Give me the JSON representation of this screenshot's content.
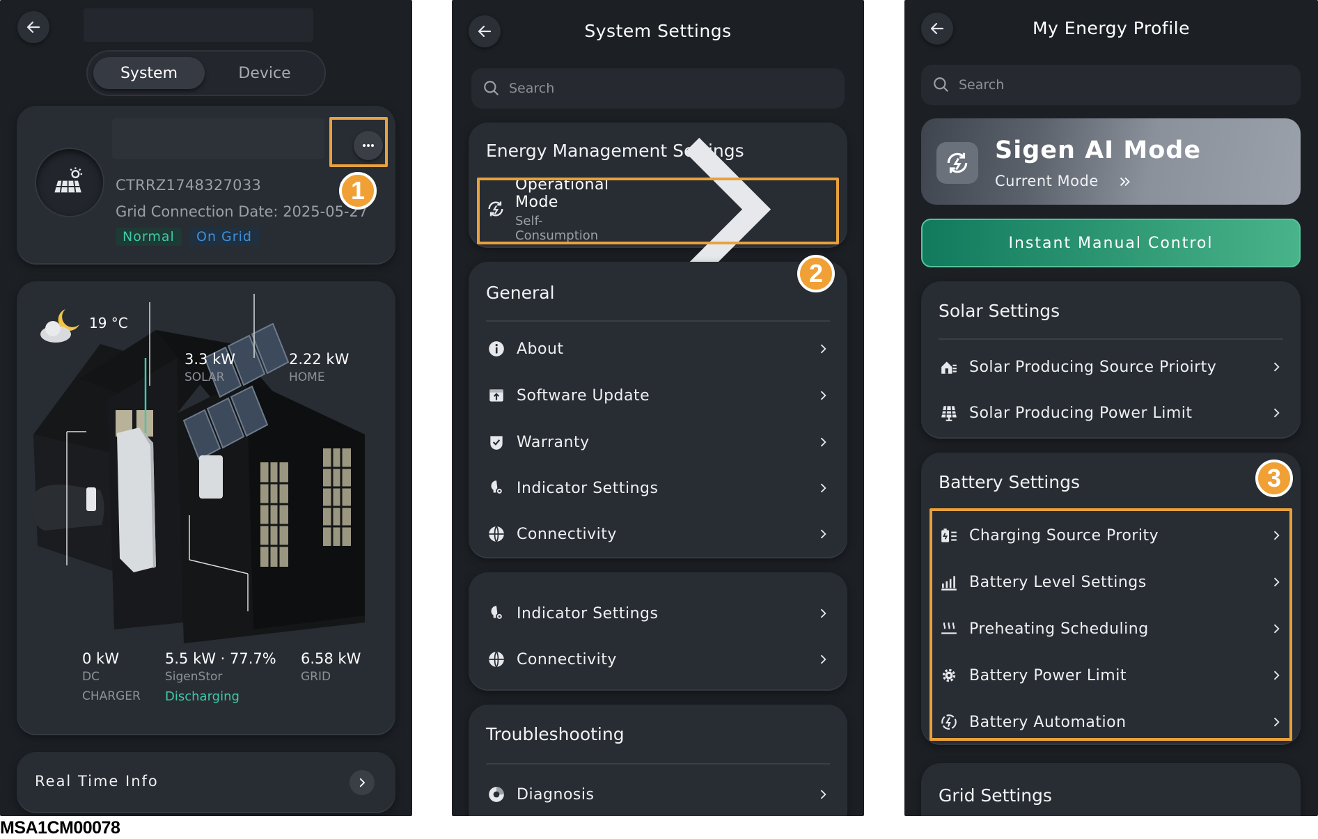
{
  "panel1": {
    "tabs": {
      "system": "System",
      "device": "Device"
    },
    "device_id": "CTRRZ1748327033",
    "grid_connection": "Grid Connection Date: 2025-05-27",
    "tag_normal": "Normal",
    "tag_ongrid": "On Grid",
    "temperature": "19 °C",
    "flows": {
      "solar_value": "3.3 kW",
      "solar_label": "SOLAR",
      "home_value": "2.22 kW",
      "home_label": "HOME",
      "charger_value": "0 kW",
      "charger_label1": "DC",
      "charger_label2": "CHARGER",
      "sigenstor_value": "5.5 kW · 77.7%",
      "sigenstor_label": "SigenStor",
      "sigenstor_status": "Discharging",
      "grid_value": "6.58 kW",
      "grid_label": "GRID"
    },
    "real_time": "Real Time Info",
    "badge": "1"
  },
  "panel2": {
    "title": "System Settings",
    "search_placeholder": "Search",
    "energy_header": "Energy Management Settings",
    "op_mode_label": "Operational Mode",
    "op_mode_value": "Self-Consumption",
    "badge": "2",
    "general_header": "General",
    "general_items": [
      "About",
      "Software Update",
      "Warranty",
      "Indicator Settings",
      "Connectivity"
    ],
    "extra_items": [
      "Indicator Settings",
      "Connectivity"
    ],
    "troubleshooting_header": "Troubleshooting",
    "troubleshooting_items": [
      "Diagnosis"
    ]
  },
  "panel3": {
    "title": "My Energy Profile",
    "search_placeholder": "Search",
    "ai_title": "Sigen AI Mode",
    "ai_sub": "Current Mode",
    "instant": "Instant Manual Control",
    "solar_header": "Solar Settings",
    "solar_items": [
      "Solar Producing Source Prioirty",
      "Solar Producing Power Limit"
    ],
    "battery_header": "Battery Settings",
    "battery_items": [
      "Charging Source Prority",
      "Battery Level Settings",
      "Preheating Scheduling",
      "Battery Power Limit",
      "Battery Automation"
    ],
    "grid_header": "Grid Settings",
    "badge": "3"
  },
  "caption": "MSA1CM00078",
  "colors": {
    "accent": "#e9a13b",
    "teal": "#3fc9a9",
    "blue": "#3f8fd8",
    "panel": "#1c1f24",
    "card": "#282c33"
  }
}
